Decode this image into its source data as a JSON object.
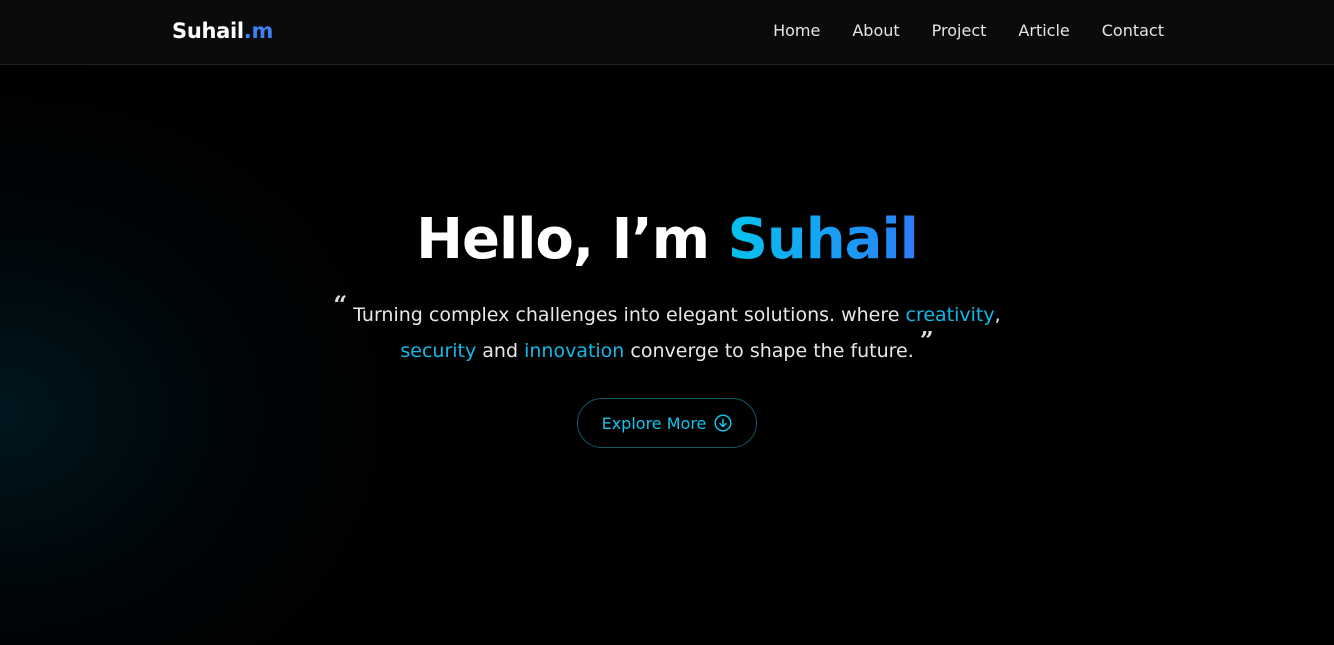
{
  "logo": {
    "name": "Suhail",
    "accent": ".m"
  },
  "nav": {
    "items": [
      "Home",
      "About",
      "Project",
      "Article",
      "Contact"
    ]
  },
  "hero": {
    "greeting": "Hello, I’m ",
    "name": "Suhail",
    "quote_open": "“",
    "quote_close": "”",
    "quote_parts": {
      "p1": " Turning complex challenges into elegant solutions. where ",
      "creativity": "creativity",
      "p2": ",",
      "security": "security",
      "p3": " and ",
      "innovation": "innovation",
      "p4": " converge to shape the future. "
    },
    "button_label": "Explore More",
    "button_icon": "arrow-down-circle-icon"
  },
  "colors": {
    "background": "#000000",
    "header": "#0b0b0b",
    "accent": "#14b8e6",
    "logo_accent": "#3b82f6"
  }
}
